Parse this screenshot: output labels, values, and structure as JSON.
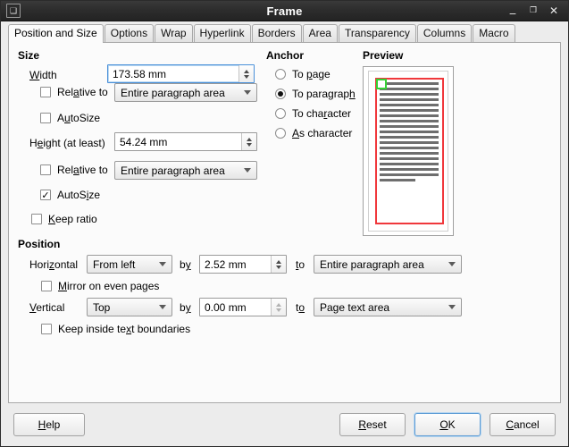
{
  "window": {
    "title": "Frame",
    "app_icon": "document-icon",
    "minimize": "–",
    "maximize": "□",
    "close": "✕"
  },
  "tabs": [
    {
      "label": "Position and Size",
      "active": true
    },
    {
      "label": "Options",
      "active": false
    },
    {
      "label": "Wrap",
      "active": false
    },
    {
      "label": "Hyperlink",
      "active": false
    },
    {
      "label": "Borders",
      "active": false
    },
    {
      "label": "Area",
      "active": false
    },
    {
      "label": "Transparency",
      "active": false
    },
    {
      "label": "Columns",
      "active": false
    },
    {
      "label": "Macro",
      "active": false
    }
  ],
  "size": {
    "group_label": "Size",
    "width_label": "Width",
    "width_value": "173.58 mm",
    "width_relative_label": "Relative to",
    "width_relative_value": "Entire paragraph area",
    "width_relative_checked": false,
    "width_autosize_label": "AutoSize",
    "width_autosize_checked": false,
    "height_label": "Height (at least)",
    "height_value": "54.24 mm",
    "height_relative_label": "Relative to",
    "height_relative_value": "Entire paragraph area",
    "height_relative_checked": false,
    "height_autosize_label": "AutoSize",
    "height_autosize_checked": true,
    "keep_ratio_label": "Keep ratio",
    "keep_ratio_checked": false,
    "checkmark": "✓"
  },
  "anchor": {
    "group_label": "Anchor",
    "options": [
      {
        "label": "To page",
        "selected": false
      },
      {
        "label": "To paragraph",
        "selected": true
      },
      {
        "label": "To character",
        "selected": false
      },
      {
        "label": "As character",
        "selected": false
      }
    ]
  },
  "preview": {
    "group_label": "Preview",
    "frame_color": "#f0383c",
    "anchor_color": "#35d035",
    "text_line_color": "#6e6e6e",
    "text_line_count": 19
  },
  "position": {
    "group_label": "Position",
    "horizontal_label": "Horizontal",
    "horizontal_value": "From left",
    "horizontal_by_label": "by",
    "horizontal_by_value": "2.52 mm",
    "horizontal_to_label": "to",
    "horizontal_to_value": "Entire paragraph area",
    "mirror_label": "Mirror on even pages",
    "mirror_checked": false,
    "vertical_label": "Vertical",
    "vertical_value": "Top",
    "vertical_by_label": "by",
    "vertical_by_value": "0.00 mm",
    "vertical_to_label": "to",
    "vertical_to_value": "Page text area",
    "keep_inside_label": "Keep inside text boundaries",
    "keep_inside_checked": false
  },
  "buttons": {
    "help": "Help",
    "reset": "Reset",
    "ok": "OK",
    "cancel": "Cancel"
  }
}
